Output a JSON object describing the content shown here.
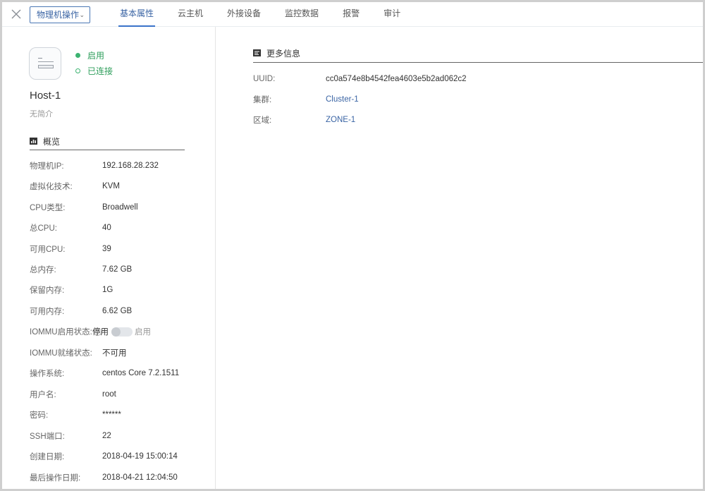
{
  "toolbar": {
    "ops_label": "物理机操作",
    "tabs": [
      {
        "label": "基本属性",
        "active": true
      },
      {
        "label": "云主机"
      },
      {
        "label": "外接设备"
      },
      {
        "label": "监控数据"
      },
      {
        "label": "报警"
      },
      {
        "label": "审计"
      }
    ]
  },
  "host": {
    "state": "启用",
    "status": "已连接",
    "name": "Host-1",
    "description": "无简介"
  },
  "overview": {
    "title": "概览",
    "rows": [
      {
        "label": "物理机IP:",
        "value": "192.168.28.232"
      },
      {
        "label": "虚拟化技术:",
        "value": "KVM"
      },
      {
        "label": "CPU类型:",
        "value": "Broadwell"
      },
      {
        "label": "总CPU:",
        "value": "40"
      },
      {
        "label": "可用CPU:",
        "value": "39"
      },
      {
        "label": "总内存:",
        "value": "7.62 GB"
      },
      {
        "label": "保留内存:",
        "value": "1G"
      },
      {
        "label": "可用内存:",
        "value": "6.62 GB"
      },
      {
        "label": "IOMMU启用状态:",
        "toggle_off": "停用",
        "toggle_on": "启用",
        "toggle_state": false
      },
      {
        "label": "IOMMU就绪状态:",
        "value": "不可用"
      },
      {
        "label": "操作系统:",
        "value": "centos Core 7.2.1511"
      },
      {
        "label": "用户名:",
        "value": "root"
      },
      {
        "label": "密码:",
        "value": "******"
      },
      {
        "label": "SSH端口:",
        "value": "22"
      },
      {
        "label": "创建日期:",
        "value": "2018-04-19 15:00:14"
      },
      {
        "label": "最后操作日期:",
        "value": "2018-04-21 12:04:50"
      }
    ]
  },
  "more_info": {
    "title": "更多信息",
    "uuid_label": "UUID:",
    "uuid": "cc0a574e8b4542fea4603e5b2ad062c2",
    "cluster_label": "集群:",
    "cluster": "Cluster-1",
    "zone_label": "区域:",
    "zone": "ZONE-1"
  },
  "colors": {
    "accent": "#3a64a4",
    "status_green": "#3cb371"
  }
}
